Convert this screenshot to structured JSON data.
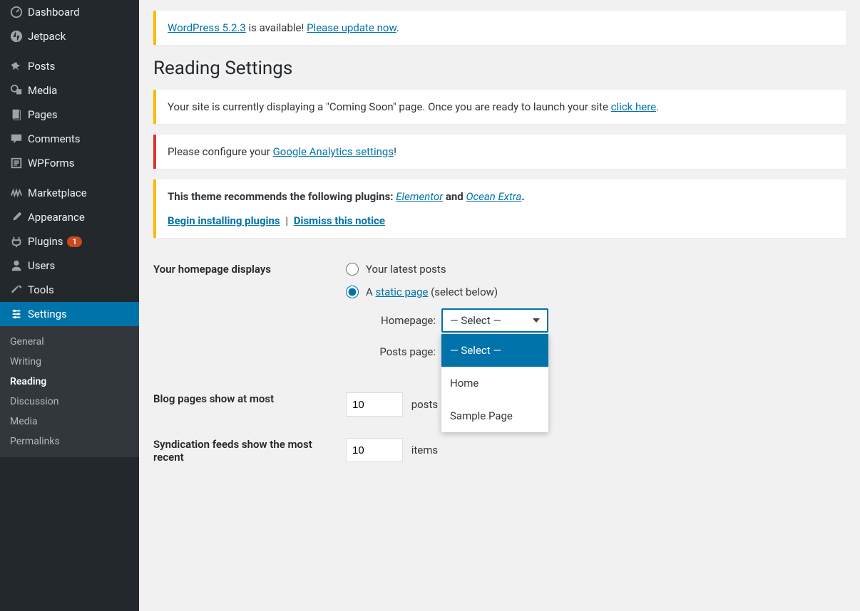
{
  "sidebar": {
    "items": [
      {
        "label": "Dashboard",
        "icon": "dashboard"
      },
      {
        "label": "Jetpack",
        "icon": "jetpack"
      },
      {
        "label": "Posts",
        "icon": "pin"
      },
      {
        "label": "Media",
        "icon": "media"
      },
      {
        "label": "Pages",
        "icon": "page"
      },
      {
        "label": "Comments",
        "icon": "comment"
      },
      {
        "label": "WPForms",
        "icon": "form"
      },
      {
        "label": "Marketplace",
        "icon": "marketplace"
      },
      {
        "label": "Appearance",
        "icon": "brush"
      },
      {
        "label": "Plugins",
        "icon": "plugin",
        "badge": "1"
      },
      {
        "label": "Users",
        "icon": "user"
      },
      {
        "label": "Tools",
        "icon": "wrench"
      },
      {
        "label": "Settings",
        "icon": "settings",
        "current": true
      }
    ],
    "submenu": [
      {
        "label": "General"
      },
      {
        "label": "Writing"
      },
      {
        "label": "Reading",
        "current": true
      },
      {
        "label": "Discussion"
      },
      {
        "label": "Media"
      },
      {
        "label": "Permalinks"
      }
    ]
  },
  "notices": {
    "update": {
      "link1": "WordPress 5.2.3",
      "mid": " is available! ",
      "link2": "Please update now",
      "tail": "."
    },
    "coming_soon": {
      "pre": "Your site is currently displaying a \"Coming Soon\" page. Once you are ready to launch your site ",
      "link": "click here",
      "tail": "."
    },
    "ga": {
      "pre": "Please configure your ",
      "link": "Google Analytics settings",
      "tail": "!"
    },
    "theme": {
      "pre": "This theme recommends the following plugins: ",
      "plugin1": "Elementor",
      "and": " and ",
      "plugin2": "Ocean Extra",
      "tail": ".",
      "action1": "Begin installing plugins",
      "action2": "Dismiss this notice"
    }
  },
  "page": {
    "title": "Reading Settings"
  },
  "form": {
    "homepage_displays": {
      "label": "Your homepage displays",
      "opt_latest": "Your latest posts",
      "opt_static_pre": "A ",
      "opt_static_link": "static page",
      "opt_static_post": " (select below)",
      "homepage_label": "Homepage:",
      "posts_page_label": "Posts page:",
      "select_placeholder": "— Select —",
      "options": [
        "— Select —",
        "Home",
        "Sample Page"
      ]
    },
    "blog_pages": {
      "label": "Blog pages show at most",
      "value": "10",
      "suffix": "posts"
    },
    "syndication": {
      "label": "Syndication feeds show the most recent",
      "value": "10",
      "suffix": "items"
    }
  }
}
